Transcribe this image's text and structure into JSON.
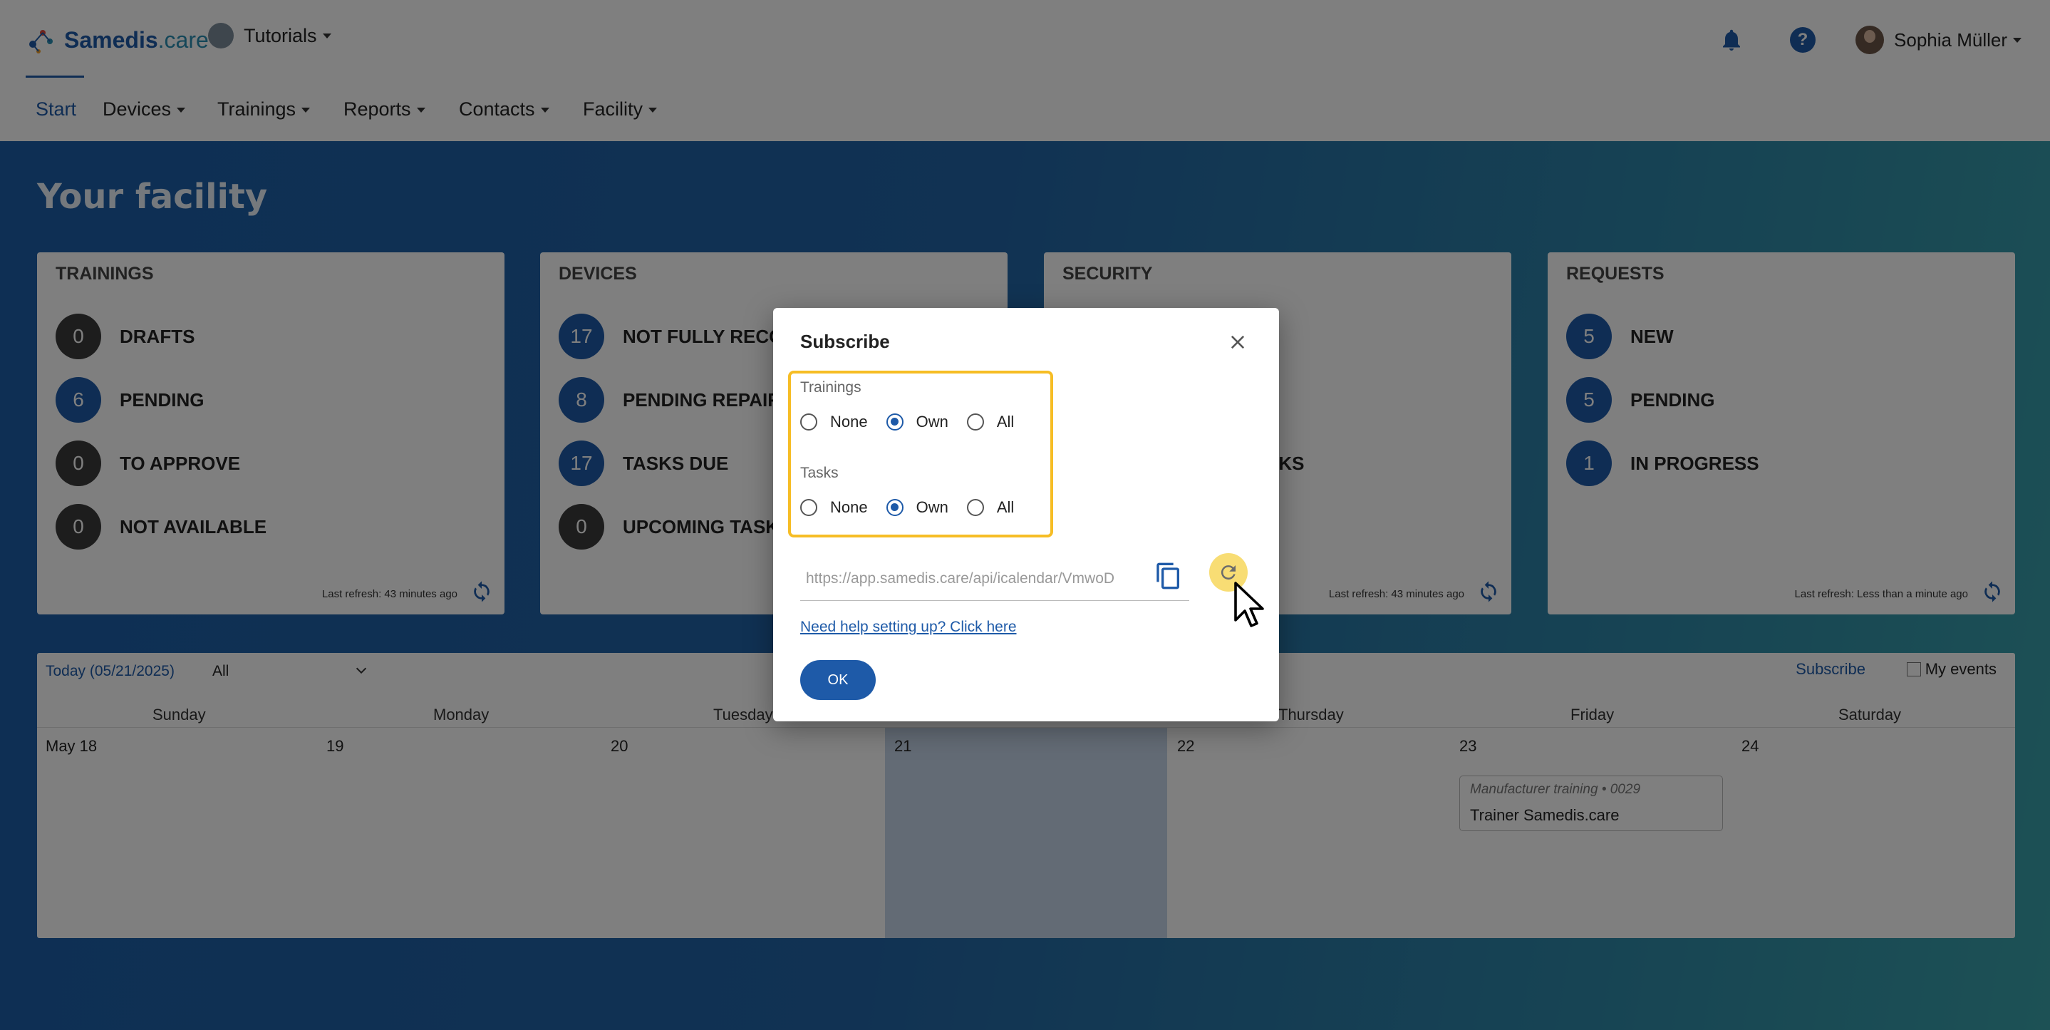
{
  "header": {
    "logo_brand": "Samedis",
    "logo_suffix": ".care",
    "tenant": "Tutorials",
    "user": "Sophia Müller",
    "icons": [
      "bell-icon",
      "help-icon",
      "avatar"
    ]
  },
  "nav": {
    "items": [
      "Start",
      "Devices",
      "Trainings",
      "Reports",
      "Contacts",
      "Facility"
    ],
    "active": "Start"
  },
  "hero": {
    "title": "Your facility"
  },
  "cards": [
    {
      "title": "TRAININGS",
      "rows": [
        {
          "count": "0",
          "label": "DRAFTS"
        },
        {
          "count": "6",
          "label": "PENDING"
        },
        {
          "count": "0",
          "label": "TO APPROVE"
        },
        {
          "count": "0",
          "label": "NOT AVAILABLE"
        }
      ],
      "refresh": "Last refresh: 43 minutes ago"
    },
    {
      "title": "DEVICES",
      "rows": [
        {
          "count": "17",
          "label": "NOT FULLY RECOR"
        },
        {
          "count": "8",
          "label": "PENDING REPAIRS"
        },
        {
          "count": "17",
          "label": "TASKS DUE"
        },
        {
          "count": "0",
          "label": "UPCOMING TASKS"
        }
      ],
      "refresh": ""
    },
    {
      "title": "SECURITY",
      "partial_label": "SKS",
      "refresh": "Last refresh: 43 minutes ago"
    },
    {
      "title": "REQUESTS",
      "rows": [
        {
          "count": "5",
          "label": "NEW"
        },
        {
          "count": "5",
          "label": "PENDING"
        },
        {
          "count": "1",
          "label": "IN PROGRESS"
        }
      ],
      "refresh": "Last refresh: Less than a minute ago"
    }
  ],
  "calendar": {
    "today": "Today (05/21/2025)",
    "filter": "All",
    "subscribe": "Subscribe",
    "my_events": "My events",
    "days": [
      "Sunday",
      "Monday",
      "Tuesday",
      "Thursday",
      "Friday",
      "Saturday"
    ],
    "dates": [
      "May 18",
      "19",
      "20",
      "21",
      "22",
      "23",
      "24"
    ],
    "event": {
      "subtitle": "Manufacturer training • 0029",
      "title": "Trainer Samedis.care"
    }
  },
  "dialog": {
    "title": "Subscribe",
    "trainings_label": "Trainings",
    "tasks_label": "Tasks",
    "options": [
      "None",
      "Own",
      "All"
    ],
    "trainings_selected": "Own",
    "tasks_selected": "Own",
    "url": "https://app.samedis.care/api/icalendar/VmwoD",
    "help_link": "Need help setting up? Click here",
    "ok": "OK",
    "highlight_color": "#f6bd25"
  }
}
